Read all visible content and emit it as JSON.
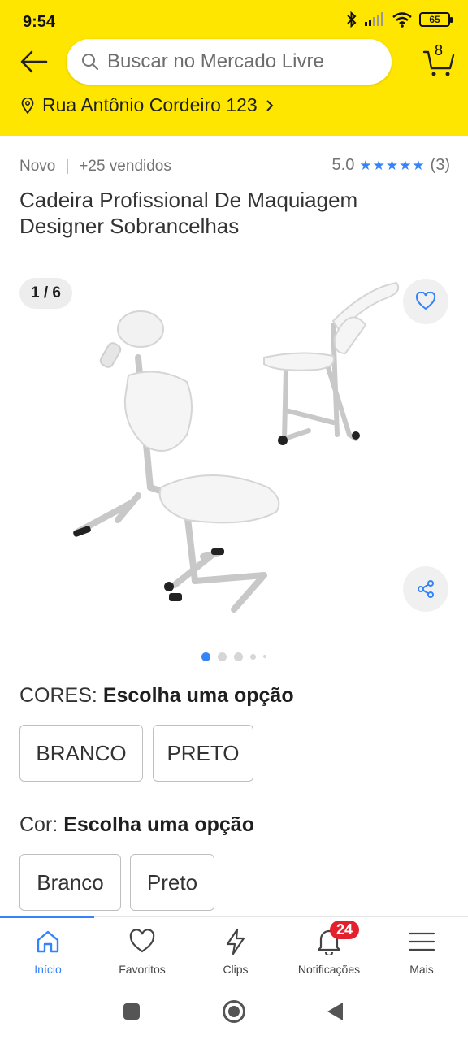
{
  "status_bar": {
    "time": "9:54",
    "battery": "65"
  },
  "header": {
    "search_placeholder": "Buscar no Mercado Livre",
    "cart_count": "8",
    "location": "Rua Antônio Cordeiro 123"
  },
  "product": {
    "condition": "Novo",
    "sold": "+25 vendidos",
    "rating_value": "5.0",
    "rating_count": "(3)",
    "title": "Cadeira Profissional De Maquiagem Designer Sobrancelhas",
    "image_counter": "1 / 6"
  },
  "variations": [
    {
      "label": "CORES:",
      "value": "Escolha uma opção",
      "options": [
        "BRANCO",
        "PRETO"
      ]
    },
    {
      "label": "Cor:",
      "value": "Escolha uma opção",
      "options": [
        "Branco",
        "Preto"
      ]
    }
  ],
  "bottom_nav": [
    {
      "label": "Início",
      "icon": "home-icon",
      "active": true
    },
    {
      "label": "Favoritos",
      "icon": "heart-icon"
    },
    {
      "label": "Clips",
      "icon": "lightning-icon"
    },
    {
      "label": "Notificações",
      "icon": "bell-icon",
      "badge": "24"
    },
    {
      "label": "Mais",
      "icon": "menu-icon"
    }
  ],
  "colors": {
    "brand_yellow": "#FFE600",
    "accent_blue": "#3483FA",
    "badge_red": "#e4202d"
  }
}
